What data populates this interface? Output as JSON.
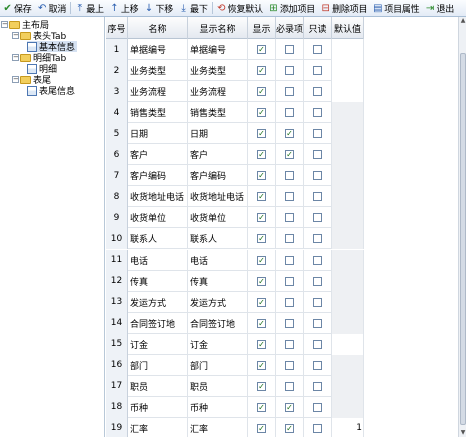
{
  "toolbar": {
    "save": "保存",
    "cancel": "取消",
    "top": "最上",
    "up": "上移",
    "down": "下移",
    "bottom": "最下",
    "restore_default": "恢复默认",
    "add_item": "添加项目",
    "delete_item": "删除项目",
    "item_props": "项目属性",
    "exit": "退出"
  },
  "tree": {
    "root": "主布局",
    "header_tab": "表头Tab",
    "basic_info": "基本信息",
    "detail_tab": "明细Tab",
    "detail": "明细",
    "footer": "表尾",
    "footer_info": "表尾信息"
  },
  "grid": {
    "headers": [
      "序号",
      "名称",
      "显示名称",
      "显示",
      "必录项",
      "只读",
      "默认值"
    ],
    "rows": [
      {
        "seq": "1",
        "name": "单据编号",
        "display": "单据编号",
        "show": true,
        "required": false,
        "readonly": false,
        "default": "",
        "def_gray": false
      },
      {
        "seq": "2",
        "name": "业务类型",
        "display": "业务类型",
        "show": true,
        "required": false,
        "readonly": false,
        "default": "",
        "def_gray": false
      },
      {
        "seq": "3",
        "name": "业务流程",
        "display": "业务流程",
        "show": true,
        "required": false,
        "readonly": false,
        "default": "",
        "def_gray": false
      },
      {
        "seq": "4",
        "name": "销售类型",
        "display": "销售类型",
        "show": true,
        "required": false,
        "readonly": false,
        "default": "",
        "def_gray": true
      },
      {
        "seq": "5",
        "name": "日期",
        "display": "日期",
        "show": true,
        "required": true,
        "readonly": false,
        "default": "",
        "def_gray": true
      },
      {
        "seq": "6",
        "name": "客户",
        "display": "客户",
        "show": true,
        "required": true,
        "readonly": false,
        "default": "",
        "def_gray": true
      },
      {
        "seq": "7",
        "name": "客户编码",
        "display": "客户编码",
        "show": true,
        "required": false,
        "readonly": false,
        "default": "",
        "def_gray": true
      },
      {
        "seq": "8",
        "name": "收货地址电话",
        "display": "收货地址电话",
        "show": true,
        "required": false,
        "readonly": false,
        "default": "",
        "def_gray": true
      },
      {
        "seq": "9",
        "name": "收货单位",
        "display": "收货单位",
        "show": true,
        "required": false,
        "readonly": false,
        "default": "",
        "def_gray": true
      },
      {
        "seq": "10",
        "name": "联系人",
        "display": "联系人",
        "show": true,
        "required": false,
        "readonly": false,
        "default": "",
        "def_gray": true
      },
      {
        "seq": "11",
        "name": "电话",
        "display": "电话",
        "show": true,
        "required": false,
        "readonly": false,
        "default": "",
        "def_gray": true
      },
      {
        "seq": "12",
        "name": "传真",
        "display": "传真",
        "show": true,
        "required": false,
        "readonly": false,
        "default": "",
        "def_gray": true
      },
      {
        "seq": "13",
        "name": "发运方式",
        "display": "发运方式",
        "show": true,
        "required": false,
        "readonly": false,
        "default": "",
        "def_gray": true
      },
      {
        "seq": "14",
        "name": "合同签订地",
        "display": "合同签订地",
        "show": true,
        "required": false,
        "readonly": false,
        "default": "",
        "def_gray": true
      },
      {
        "seq": "15",
        "name": "订金",
        "display": "订金",
        "show": true,
        "required": false,
        "readonly": false,
        "default": "",
        "def_gray": false
      },
      {
        "seq": "16",
        "name": "部门",
        "display": "部门",
        "show": true,
        "required": false,
        "readonly": false,
        "default": "",
        "def_gray": true
      },
      {
        "seq": "17",
        "name": "职员",
        "display": "职员",
        "show": true,
        "required": false,
        "readonly": false,
        "default": "",
        "def_gray": true
      },
      {
        "seq": "18",
        "name": "币种",
        "display": "币种",
        "show": true,
        "required": true,
        "readonly": false,
        "default": "",
        "def_gray": true
      },
      {
        "seq": "19",
        "name": "汇率",
        "display": "汇率",
        "show": true,
        "required": true,
        "readonly": false,
        "default": "1",
        "def_gray": false
      }
    ]
  }
}
